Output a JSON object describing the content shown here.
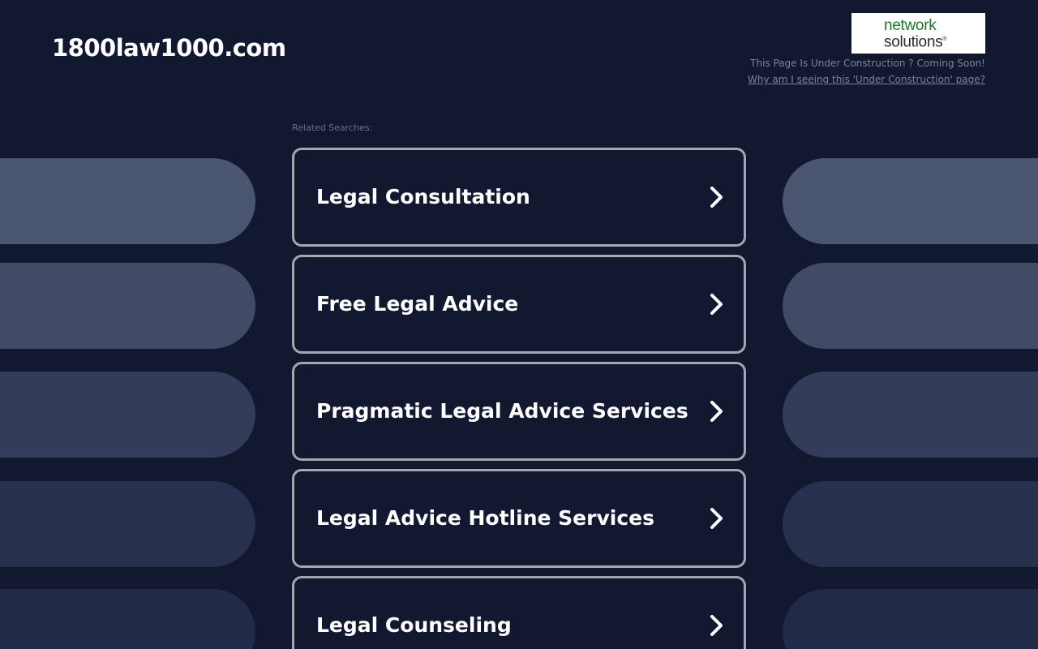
{
  "header": {
    "domain": "1800law1000.com",
    "logo": {
      "line1": "network",
      "line2": "solutions",
      "registered_mark": "®"
    },
    "construction_notice": "This Page Is Under Construction ? Coming Soon!",
    "construction_link": "Why am I seeing this 'Under Construction' page?"
  },
  "related": {
    "label": "Related Searches:",
    "items": [
      {
        "label": "Legal Consultation"
      },
      {
        "label": "Free Legal Advice"
      },
      {
        "label": "Pragmatic Legal Advice Services"
      },
      {
        "label": "Legal Advice Hotline Services"
      },
      {
        "label": "Legal Counseling"
      }
    ]
  },
  "icons": {
    "arrow": "chevron-right-icon"
  },
  "colors": {
    "background": "#111830",
    "button_border": "#a3a7b0",
    "text_primary": "#ffffff",
    "text_muted": "#7c8398",
    "logo_green": "#1f7a2e",
    "pill_shades": [
      "#4a5570",
      "#414b66",
      "#333d5a",
      "#27304c",
      "#212a47"
    ]
  }
}
